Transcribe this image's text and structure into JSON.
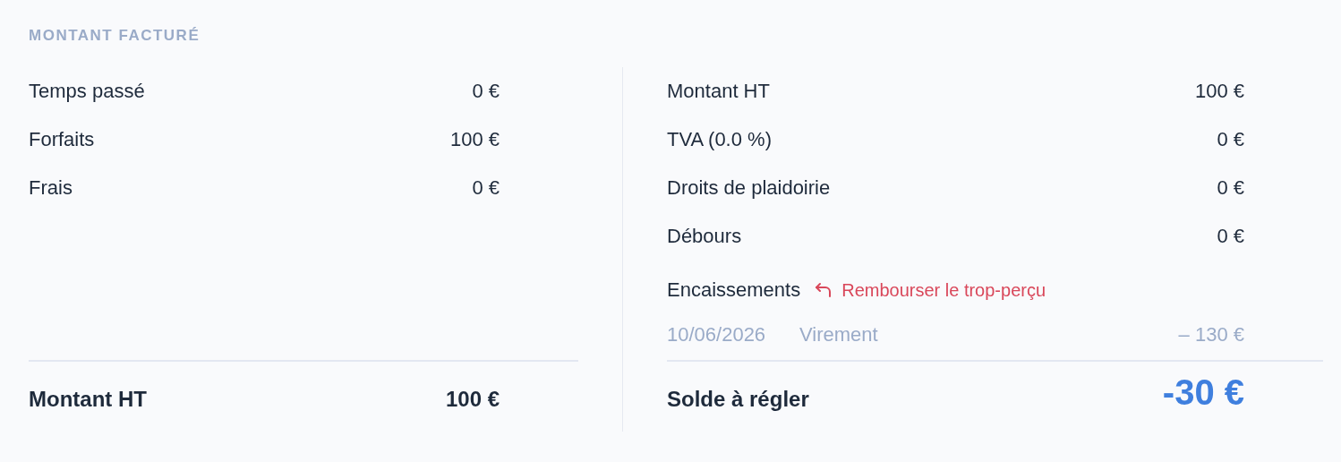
{
  "section_title": "MONTANT FACTURÉ",
  "left": {
    "rows": [
      {
        "label": "Temps passé",
        "value": "0 €"
      },
      {
        "label": "Forfaits",
        "value": "100 €"
      },
      {
        "label": "Frais",
        "value": "0 €"
      }
    ],
    "total": {
      "label": "Montant HT",
      "value": "100 €"
    }
  },
  "right": {
    "rows": [
      {
        "label": "Montant HT",
        "value": "100 €"
      },
      {
        "label": "TVA (0.0 %)",
        "value": "0 €"
      },
      {
        "label": "Droits de plaidoirie",
        "value": "0 €"
      },
      {
        "label": "Débours",
        "value": "0 €"
      }
    ],
    "payments": {
      "label": "Encaissements",
      "action": "Rembourser le trop-perçu",
      "items": [
        {
          "date": "10/06/2026",
          "method": "Virement",
          "amount": "– 130 €"
        }
      ]
    },
    "total": {
      "label": "Solde à régler",
      "value": "-30 €"
    }
  }
}
